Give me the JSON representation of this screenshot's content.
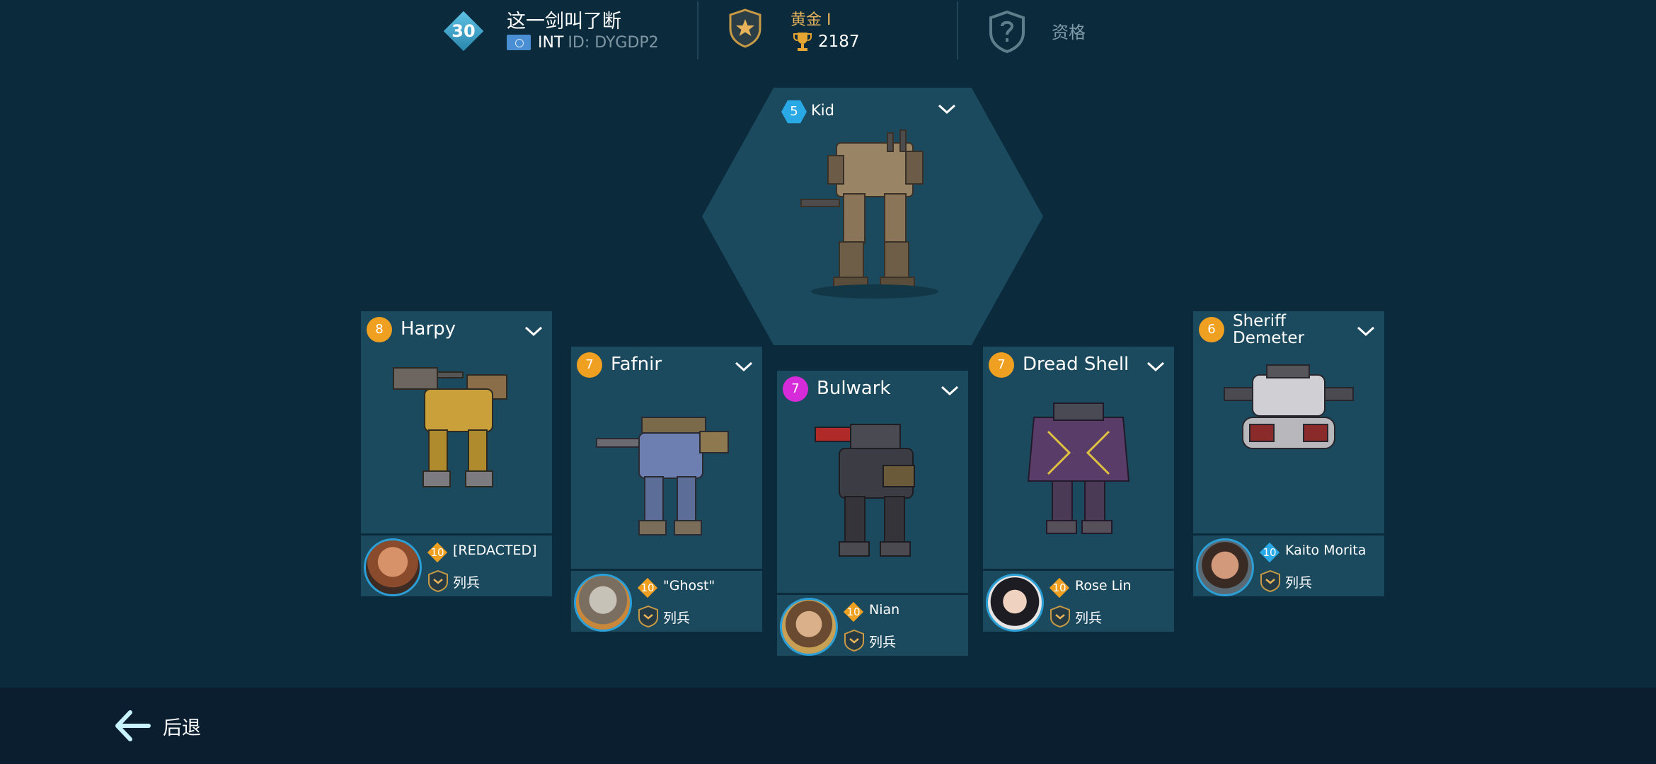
{
  "player": {
    "level": "30",
    "name": "这一剑叫了断",
    "region": "INT",
    "id": "ID: DYGDP2",
    "league": "黄金 I",
    "trophies": "2187",
    "qualification": "资格"
  },
  "top_robot": {
    "level": "5",
    "name": "Kid",
    "level_color": "#29a9e6"
  },
  "cards": [
    {
      "level": "8",
      "name": "Harpy",
      "level_color": "#f0a020",
      "pilot_level": "10",
      "pilot_name": "[REDACTED]",
      "rank": "列兵"
    },
    {
      "level": "7",
      "name": "Fafnir",
      "level_color": "#f0a020",
      "pilot_level": "10",
      "pilot_name": "\"Ghost\"",
      "rank": "列兵"
    },
    {
      "level": "7",
      "name": "Bulwark",
      "level_color": "#d62bd8",
      "pilot_level": "10",
      "pilot_name": "Nian",
      "rank": "列兵"
    },
    {
      "level": "7",
      "name": "Dread Shell",
      "level_color": "#f0a020",
      "pilot_level": "10",
      "pilot_name": "Rose Lin",
      "rank": "列兵"
    },
    {
      "level": "6",
      "name": "Sheriff Demeter",
      "level_color": "#f0a020",
      "pilot_level": "10",
      "pilot_name": "Kaito Morita",
      "rank": "列兵"
    }
  ],
  "footer": {
    "back_label": "后退"
  },
  "colors": {
    "background": "#0b2b3d",
    "panel": "#1b4a5e",
    "footer": "#0a1e2f",
    "gold": "#e7b35a",
    "accent_blue": "#2c9fd6"
  },
  "icons": [
    "level-diamond-icon",
    "flag-icon",
    "league-shield-icon",
    "trophy-icon",
    "qualification-icon",
    "chevron-down-icon",
    "pilot-level-diamond-icon",
    "rank-chevron-icon",
    "back-arrow-icon"
  ]
}
